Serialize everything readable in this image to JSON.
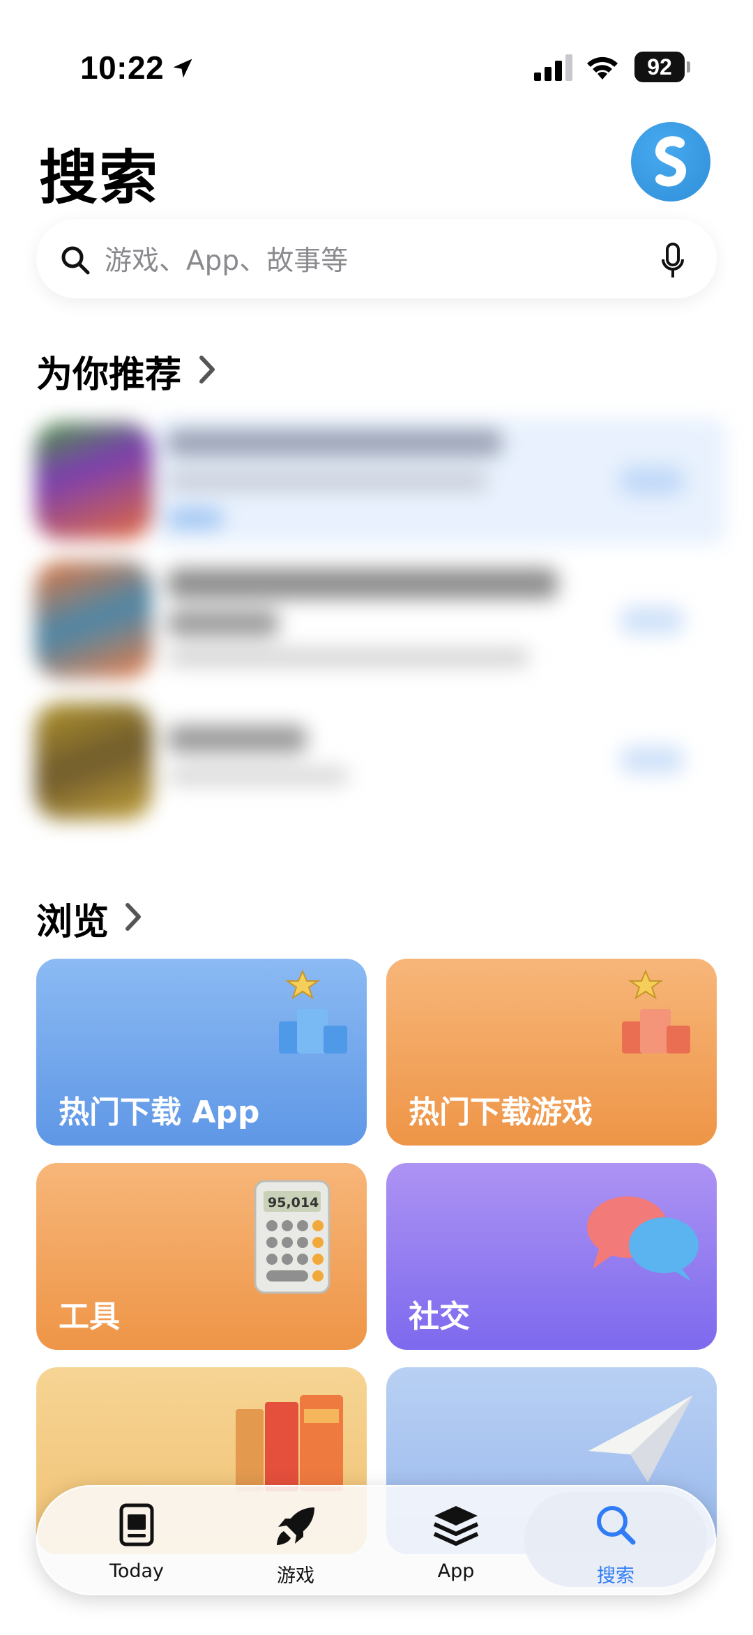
{
  "status_bar": {
    "time": "10:22",
    "battery": "92"
  },
  "header": {
    "title": "搜索"
  },
  "search": {
    "placeholder": "游戏、App、故事等"
  },
  "sections": {
    "recommended": "为你推荐",
    "browse": "浏览"
  },
  "browse_tiles": [
    {
      "label": "热门下载 App"
    },
    {
      "label": "热门下载游戏"
    },
    {
      "label": "工具"
    },
    {
      "label": "社交"
    },
    {
      "label": ""
    },
    {
      "label": ""
    }
  ],
  "calculator_display": "95,014",
  "tabs": [
    {
      "label": "Today",
      "icon": "today-icon"
    },
    {
      "label": "游戏",
      "icon": "rocket-icon"
    },
    {
      "label": "App",
      "icon": "layers-icon"
    },
    {
      "label": "搜索",
      "icon": "search-icon",
      "active": true
    }
  ],
  "colors": {
    "accent": "#2f7cf6",
    "blue_tile": "#6aa0ea",
    "orange_tile": "#f09a52",
    "purple_tile": "#8a74ee"
  }
}
